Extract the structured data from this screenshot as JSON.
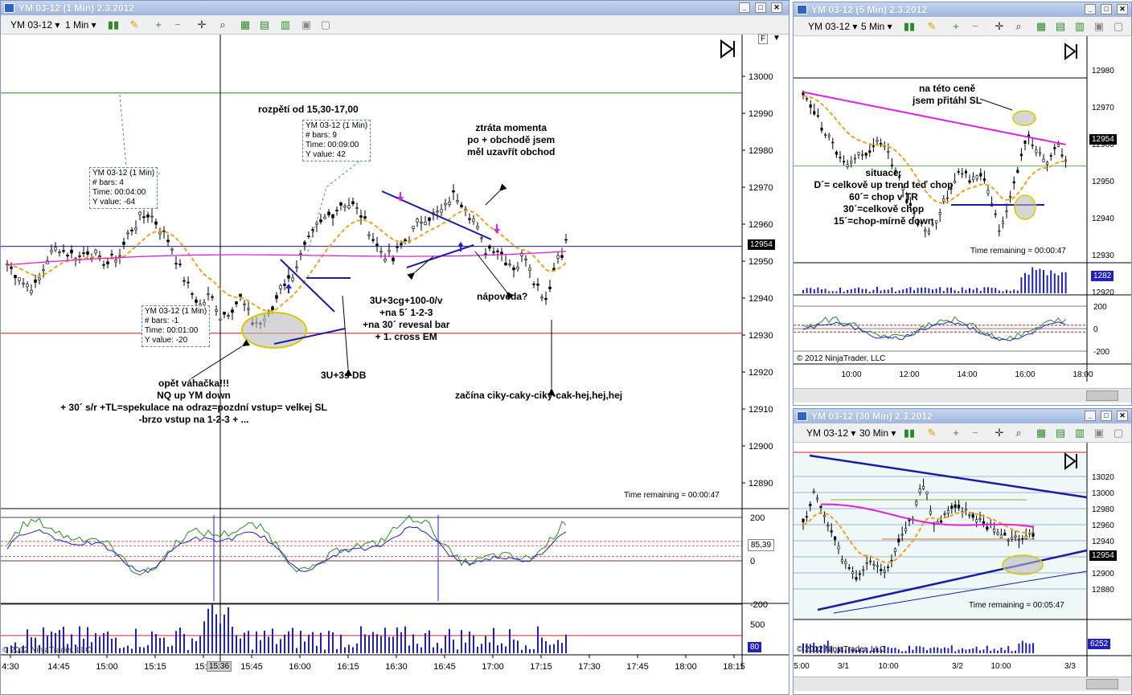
{
  "main": {
    "title": "YM 03-12 (1 Min)  2.3.2012",
    "instrument": "YM 03-12",
    "interval": "1 Min",
    "current_price": "12954",
    "time_remaining": "Time remaining = 00:00:47",
    "copyright": "© 2012 NinjaTrader, LLC",
    "indicator_value": "85,39",
    "volume_value": "80",
    "cursor_time": "15:36",
    "price_ticks": [
      "13000",
      "12990",
      "12980",
      "12970",
      "12960",
      "12950",
      "12940",
      "12930",
      "12920",
      "12910",
      "12900",
      "12890"
    ],
    "osc_ticks": [
      "200",
      "0",
      "-200"
    ],
    "vol_ticks": [
      "500"
    ],
    "time_ticks": [
      "4:30",
      "14:45",
      "15:00",
      "15:15",
      "15:3",
      "15:45",
      "16:00",
      "16:15",
      "16:30",
      "16:45",
      "17:00",
      "17:15",
      "17:30",
      "17:45",
      "18:00",
      "18:15"
    ],
    "annotations": {
      "range": "rozpětí od 15,30-17,00",
      "momentum_1": "ztráta momenta",
      "momentum_2": "po + obchodě jsem",
      "momentum_3": "měl uzavřít obchod",
      "setup_1": "3U+3cg+100-0/v",
      "setup_2": "+na 5´ 1-2-3",
      "setup_3": "+na 30´ revesal bar",
      "setup_4": "+ 1. cross EM",
      "hint": "nápověda?",
      "db": "3U+3s DB",
      "scale_1": "opět váhačka!!!",
      "scale_2": "NQ up YM down",
      "scale_3": "+ 30´ s/r +TL=spekulace na odraz=pozdní vstup= velkej SL",
      "scale_4": "-brzo vstup na 1-2-3 + ...",
      "chop": "začína ciky-caky-ciky-cak-hej,hej,hej"
    },
    "info_boxes": [
      {
        "l1": "YM 03-12 (1 Min)",
        "l2": "# bars:   4",
        "l3": "Time:     00:04:00",
        "l4": "Y value: -64"
      },
      {
        "l1": "YM 03-12 (1 Min)",
        "l2": "# bars:   9",
        "l3": "Time:     00:09:00",
        "l4": "Y value: 42"
      },
      {
        "l1": "YM 03-12 (1 Min)",
        "l2": "# bars:   -1",
        "l3": "Time:     00:01:00",
        "l4": "Y value: -20"
      }
    ]
  },
  "w5": {
    "title": "YM 03-12 (5 Min)  2.3.2012",
    "instrument": "YM 03-12",
    "interval": "5 Min",
    "current_price": "12954",
    "volume_value": "1282",
    "time_remaining": "Time remaining = 00:00:47",
    "copyright": "© 2012 NinjaTrader, LLC",
    "price_ticks": [
      "12980",
      "12970",
      "12960",
      "12950",
      "12940",
      "12930",
      "12920"
    ],
    "osc_ticks": [
      "200",
      "0",
      "-200"
    ],
    "time_ticks": [
      "10:00",
      "12:00",
      "14:00",
      "16:00",
      "18:00"
    ],
    "note_1": "na této ceně",
    "note_2": "jsem přitáhl SL",
    "sit_1": "situace:",
    "sit_2": "D´= celkově up trend teď chop",
    "sit_3": "60´= chop v TR",
    "sit_4": "30´=celkově chop",
    "sit_5": "15´=chop-mírně down"
  },
  "w30": {
    "title": "YM 03-12 (30 Min)  2.3.2012",
    "instrument": "YM 03-12",
    "interval": "30 Min",
    "current_price": "12954",
    "volume_value": "6252",
    "time_remaining": "Time remaining = 00:05:47",
    "copyright": "© 2012 NinjaTrader, LLC",
    "price_ticks": [
      "13020",
      "13000",
      "12980",
      "12960",
      "12940",
      "12920",
      "12900",
      "12880"
    ],
    "time_ticks": [
      "5:00",
      "3/1",
      "10:00",
      "3/2",
      "10:00",
      "3/3"
    ]
  },
  "colors": {
    "ema_orange": "#f0a020",
    "sma_magenta": "#e020e0",
    "blue_line": "#1a1aa8",
    "red_line": "#d01818",
    "green_line": "#208a20"
  }
}
